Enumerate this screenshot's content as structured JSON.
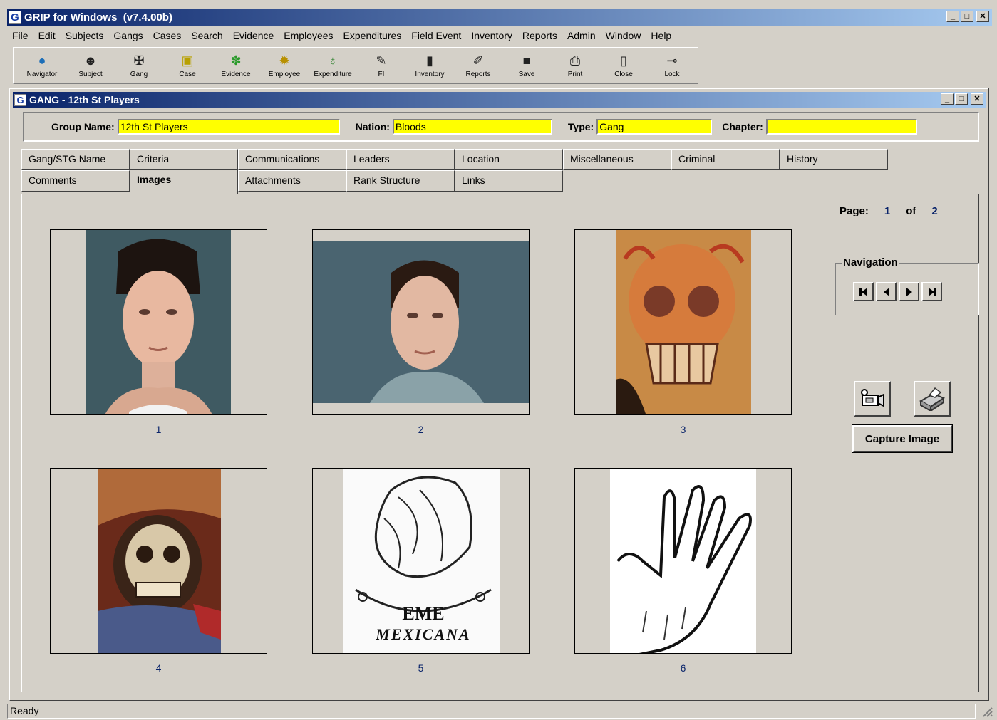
{
  "app": {
    "title": "GRIP for Windows  (v7.4.00b)",
    "logo": "G"
  },
  "menu": [
    "File",
    "Edit",
    "Subjects",
    "Gangs",
    "Cases",
    "Search",
    "Evidence",
    "Employees",
    "Expenditures",
    "Field Event",
    "Inventory",
    "Reports",
    "Admin",
    "Window",
    "Help"
  ],
  "toolbar": [
    {
      "label": "Navigator",
      "icon": "globe-icon"
    },
    {
      "label": "Subject",
      "icon": "person-icon"
    },
    {
      "label": "Gang",
      "icon": "gang-icon"
    },
    {
      "label": "Case",
      "icon": "case-icon"
    },
    {
      "label": "Evidence",
      "icon": "leaf-icon"
    },
    {
      "label": "Employee",
      "icon": "badge-icon"
    },
    {
      "label": "Expenditure",
      "icon": "money-bag-icon"
    },
    {
      "label": "FI",
      "icon": "fi-icon"
    },
    {
      "label": "Inventory",
      "icon": "inventory-icon"
    },
    {
      "label": "Reports",
      "icon": "reports-icon"
    },
    {
      "label": "Save",
      "icon": "floppy-icon"
    },
    {
      "label": "Print",
      "icon": "printer-icon"
    },
    {
      "label": "Close",
      "icon": "door-icon"
    },
    {
      "label": "Lock",
      "icon": "key-icon"
    }
  ],
  "window": {
    "title": "GANG - 12th St Players",
    "fields": {
      "group_name_label": "Group Name:",
      "group_name": "12th St Players",
      "nation_label": "Nation:",
      "nation": "Bloods",
      "type_label": "Type:",
      "type": "Gang",
      "chapter_label": "Chapter:",
      "chapter": ""
    },
    "tabs_row1": [
      "Gang/STG Name",
      "Criteria",
      "Communications",
      "Leaders",
      "Location",
      "Miscellaneous",
      "Criminal",
      "History"
    ],
    "tabs_row2": [
      "Comments",
      "Images",
      "Attachments",
      "Rank Structure",
      "Links"
    ],
    "active_tab": "Images"
  },
  "images": {
    "thumbnails": [
      "1",
      "2",
      "3",
      "4",
      "5",
      "6"
    ],
    "eme_text": "EME",
    "mexicana_text": "MEXICANA"
  },
  "pager": {
    "label": "Page:",
    "current": "1",
    "of_label": "of",
    "total": "2"
  },
  "navigation": {
    "title": "Navigation"
  },
  "capture": {
    "label": "Capture Image"
  },
  "status": {
    "text": "Ready"
  },
  "colors": {
    "title_bar_start": "#0a246a",
    "title_bar_end": "#a6caf0",
    "required_field": "#ffff00",
    "link_number": "#0a246a"
  }
}
